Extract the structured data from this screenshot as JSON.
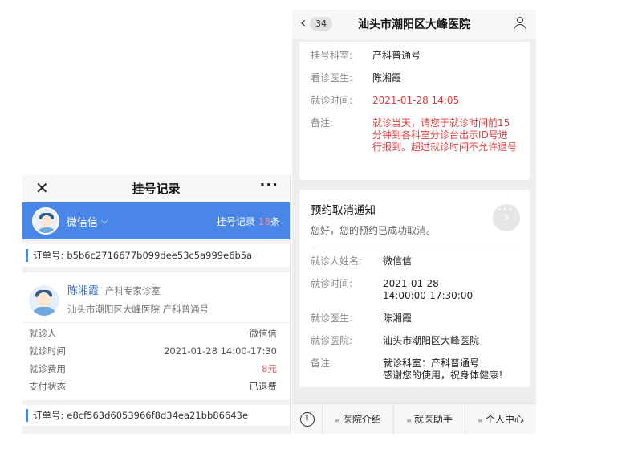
{
  "left": {
    "nav": {
      "title": "挂号记录",
      "close_icon": "close-icon",
      "more_icon": "more-icon"
    },
    "user": {
      "name": "微信信",
      "records_label": "挂号记录",
      "records_count": "18",
      "records_unit": "条"
    },
    "order1": {
      "label": "订单号:",
      "value": "b5b6c2716677b099dee53c5a999e6b5a"
    },
    "doctor": {
      "name": "陈湘霞",
      "dept": "产科专家诊室",
      "hospital_line": "汕头市潮阳区大峰医院 产科普通号"
    },
    "rows": [
      {
        "label": "就诊人",
        "value": "微信信"
      },
      {
        "label": "就诊时间",
        "value": "2021-01-28 14:00-17:30"
      },
      {
        "label": "就诊费用",
        "value": "8元"
      },
      {
        "label": "支付状态",
        "value": "已退费"
      }
    ],
    "order2": {
      "label": "订单号:",
      "value": "e8cf563d6053966f8d34ea21bb86643e"
    }
  },
  "right": {
    "nav": {
      "badge": "34",
      "title": "汕头市潮阳区大峰医院",
      "back_icon": "back-icon",
      "person_icon": "person-icon"
    },
    "card1": {
      "rows": [
        {
          "label": "挂号科室:",
          "value": "产科普通号"
        },
        {
          "label": "看诊医生:",
          "value": "陈湘霞"
        },
        {
          "label": "就诊时间:",
          "value": "2021-01-28 14:05"
        },
        {
          "label": "备注:",
          "value": "就诊当天，请您于就诊时间前15分钟到各科室分诊台出示ID号进行报到。超过就诊时间不允许退号"
        }
      ]
    },
    "card2": {
      "title": "预约取消通知",
      "subtitle": "您好，您的预约已成功取消。",
      "rows": [
        {
          "label": "就诊人姓名:",
          "value": "微信信"
        },
        {
          "label": "就诊时间:",
          "value": "2021-01-28\n14:00:00-17:30:00"
        },
        {
          "label": "就诊医生:",
          "value": "陈湘霞"
        },
        {
          "label": "就诊医院:",
          "value": "汕头市潮阳区大峰医院"
        },
        {
          "label": "备注:",
          "value": "就诊科室：产科普通号\n感谢您的使用，祝身体健康！"
        }
      ]
    },
    "tabbar": {
      "keyboard_icon": "keyboard-icon",
      "items": [
        {
          "label": "医院介绍"
        },
        {
          "label": "就医助手"
        },
        {
          "label": "个人中心"
        }
      ]
    }
  }
}
